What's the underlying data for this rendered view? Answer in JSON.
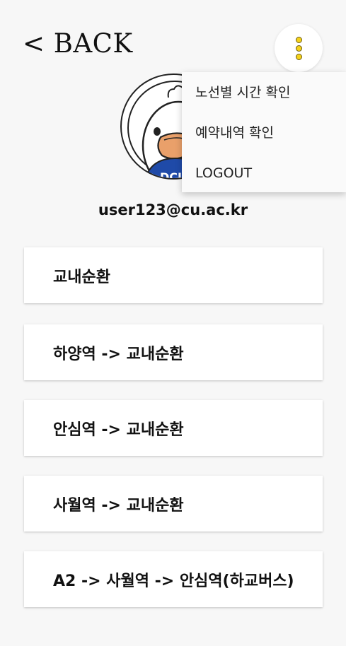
{
  "header": {
    "back_label": "< BACK"
  },
  "menu": {
    "icon": "vertical-dots-icon",
    "items": [
      {
        "label": "노선별 시간 확인"
      },
      {
        "label": "예약내역 확인"
      },
      {
        "label": "LOGOUT"
      }
    ]
  },
  "profile": {
    "email": "user123@cu.ac.kr",
    "avatar_icon": "character-avatar-icon",
    "shirt_text": "DCU"
  },
  "routes": [
    {
      "label": "교내순환"
    },
    {
      "label": "하양역 -> 교내순환"
    },
    {
      "label": "안심역 -> 교내순환"
    },
    {
      "label": "사월역 -> 교내순환"
    },
    {
      "label": "A2 -> 사월역 -> 안심역(하교버스)"
    }
  ],
  "colors": {
    "background": "#f7f7f7",
    "card": "#ffffff",
    "menu_dot": "#f5d21a",
    "shirt_blue": "#1f4aa8",
    "beak_orange": "#e9a06a"
  }
}
